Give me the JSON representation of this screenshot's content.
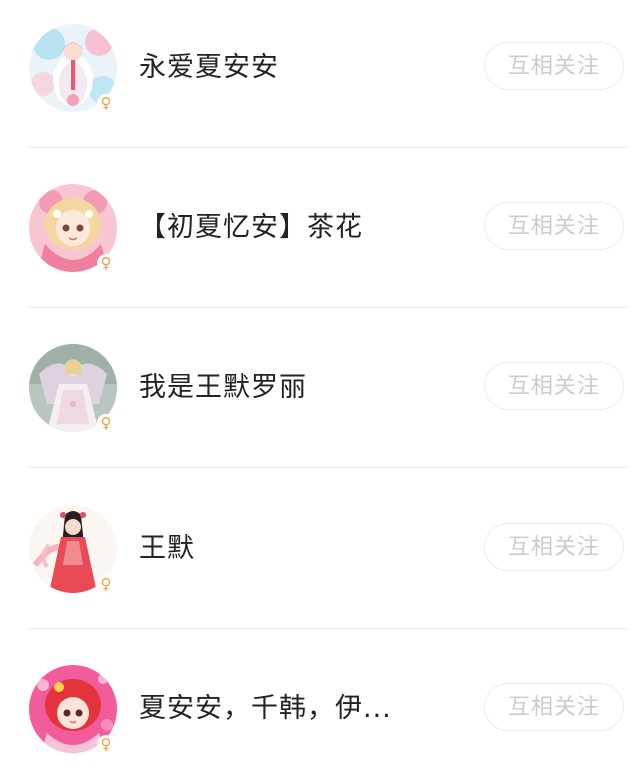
{
  "followers": [
    {
      "nickname": "永爱夏安安",
      "gender_symbol": "♀",
      "follow_label": "互相关注",
      "avatar_icon": "anime-girl-white-dress-avatar"
    },
    {
      "nickname": "【初夏忆安】茶花",
      "gender_symbol": "♀",
      "follow_label": "互相关注",
      "avatar_icon": "anime-girl-pink-hair-avatar"
    },
    {
      "nickname": "我是王默罗丽",
      "gender_symbol": "♀",
      "follow_label": "互相关注",
      "avatar_icon": "doll-white-gown-avatar"
    },
    {
      "nickname": "王默",
      "gender_symbol": "♀",
      "follow_label": "互相关注",
      "avatar_icon": "anime-girl-red-dress-avatar"
    },
    {
      "nickname": "夏安安，千韩，伊...",
      "gender_symbol": "♀",
      "follow_label": "互相关注",
      "avatar_icon": "anime-girl-red-hair-avatar"
    }
  ],
  "colors": {
    "gender_badge": "#f2a23a",
    "follow_text": "#cccccc",
    "follow_border": "#ececec",
    "divider": "#ececec",
    "nickname": "#222222"
  }
}
